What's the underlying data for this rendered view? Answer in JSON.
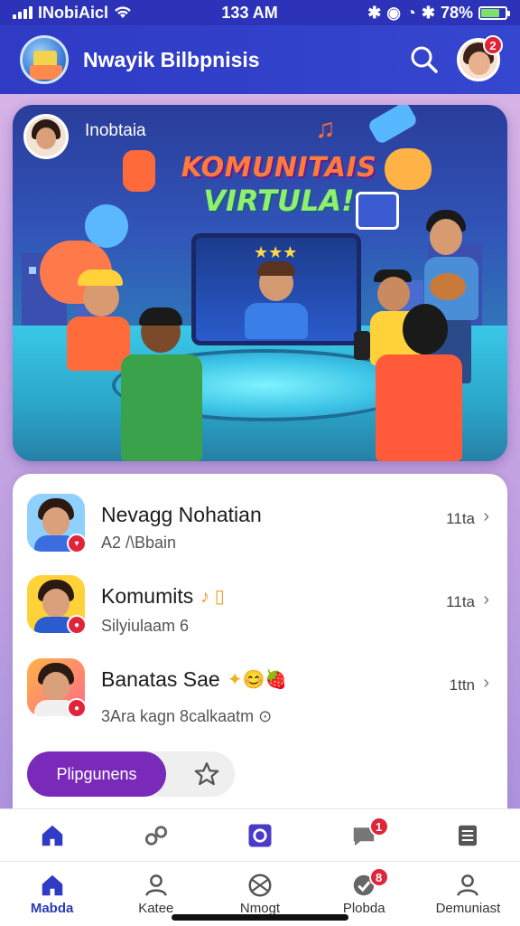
{
  "status_bar": {
    "carrier": "INobiAicl",
    "time": "133 AM",
    "battery": "78%",
    "battery_level": 0.78
  },
  "header": {
    "title": "Nwayik Bilbpnisis",
    "notification_count": "2"
  },
  "hero": {
    "label": "Inobtaia",
    "headline_line1": "KOMUNITAIS",
    "headline_line2": "VIRTULA!"
  },
  "feed": {
    "items": [
      {
        "title": "Nevagg Nohatian",
        "subtitle": "A2 /\\Bbain",
        "time": "11ta"
      },
      {
        "title": "Komumits",
        "emoji": "♪ ▯",
        "subtitle": "Silyiulaam 6",
        "time": "11ta"
      },
      {
        "title": "Banatas Sae",
        "emoji": "✦😊🍓",
        "subtitle": "3Ara kagn 8calkaatm ⊙",
        "time": "1ttn"
      }
    ],
    "pill_button": "Plipgunens"
  },
  "upper_tabs": {
    "chat_badge": "1"
  },
  "lower_tabs": {
    "items": [
      {
        "label": "Mabda",
        "active": true
      },
      {
        "label": "Katee",
        "active": false
      },
      {
        "label": "Nmogt",
        "active": false
      },
      {
        "label": "Plobda",
        "active": false,
        "badge": "8"
      },
      {
        "label": "Demuniast",
        "active": false
      }
    ]
  },
  "colors": {
    "header_bg": "#2f3bc4",
    "accent_purple": "#7a2ab8",
    "badge_red": "#e0243a",
    "active_tab": "#2a3ab8"
  }
}
